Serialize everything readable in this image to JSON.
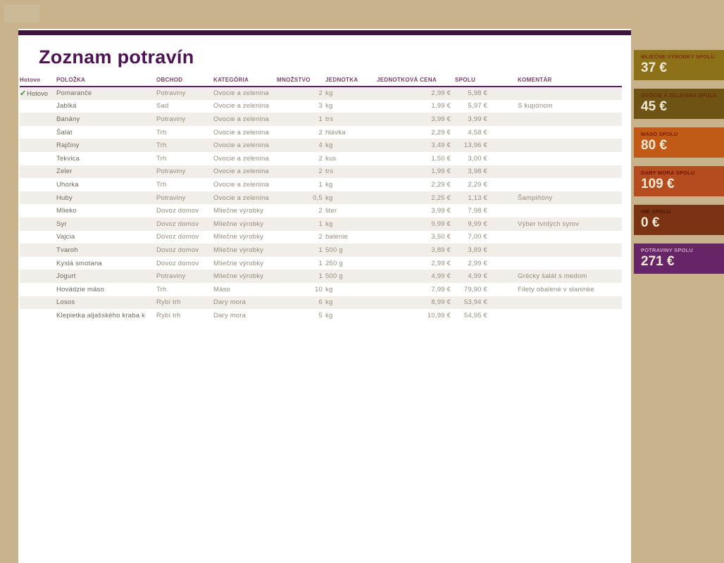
{
  "app": {
    "title": "Zoznam potravín"
  },
  "colors": {
    "page_background": "#C7B28C",
    "top_bar": "#40123F",
    "title_text": "#4C1552",
    "header_text": "#7B4166",
    "header_underline": "#5A1F5C",
    "row_stripe": "#F1EEE9",
    "body_text": "#958B7B",
    "check_green": "#2F8A32"
  },
  "table": {
    "done_text": "Hotovo",
    "headers": {
      "done": "Hotovo",
      "item": "POLOŽKA",
      "store": "OBCHOD",
      "category": "KATEGÓRIA",
      "qty": "MNOŽSTVO",
      "unit": "JEDNOTKA",
      "unit_price": "JEDNOTKOVÁ CENA",
      "total": "SPOLU",
      "comment": "KOMENTÁR"
    },
    "rows": [
      {
        "done": true,
        "item": "Pomaranče",
        "store": "Potraviny",
        "category": "Ovocie a zelenina",
        "qty": "2",
        "unit": "kg",
        "unit_price": "2,99 €",
        "total": "5,98 €",
        "comment": ""
      },
      {
        "done": false,
        "item": "Jablká",
        "store": "Sad",
        "category": "Ovocie a zelenina",
        "qty": "3",
        "unit": "kg",
        "unit_price": "1,99 €",
        "total": "5,97 €",
        "comment": "S kupónom"
      },
      {
        "done": false,
        "item": "Banány",
        "store": "Potraviny",
        "category": "Ovocie a zelenina",
        "qty": "1",
        "unit": "trs",
        "unit_price": "3,99 €",
        "total": "3,99 €",
        "comment": ""
      },
      {
        "done": false,
        "item": "Šalát",
        "store": "Trh",
        "category": "Ovocie a zelenina",
        "qty": "2",
        "unit": "hlávka",
        "unit_price": "2,29 €",
        "total": "4,58 €",
        "comment": ""
      },
      {
        "done": false,
        "item": "Rajčiny",
        "store": "Trh",
        "category": "Ovocie a zelenina",
        "qty": "4",
        "unit": "kg",
        "unit_price": "3,49 €",
        "total": "13,96 €",
        "comment": ""
      },
      {
        "done": false,
        "item": "Tekvica",
        "store": "Trh",
        "category": "Ovocie a zelenina",
        "qty": "2",
        "unit": "kus",
        "unit_price": "1,50 €",
        "total": "3,00 €",
        "comment": ""
      },
      {
        "done": false,
        "item": "Zeler",
        "store": "Potraviny",
        "category": "Ovocie a zelenina",
        "qty": "2",
        "unit": "trs",
        "unit_price": "1,99 €",
        "total": "3,98 €",
        "comment": ""
      },
      {
        "done": false,
        "item": "Uhorka",
        "store": "Trh",
        "category": "Ovocie a zelenina",
        "qty": "1",
        "unit": "kg",
        "unit_price": "2,29 €",
        "total": "2,29 €",
        "comment": ""
      },
      {
        "done": false,
        "item": "Huby",
        "store": "Potraviny",
        "category": "Ovocie a zelenina",
        "qty": "0,5",
        "unit": "kg",
        "unit_price": "2,25 €",
        "total": "1,13 €",
        "comment": "Šampiňóny"
      },
      {
        "done": false,
        "item": "Mlieko",
        "store": "Dovoz domov",
        "category": "Mliečne výrobky",
        "qty": "2",
        "unit": "liter",
        "unit_price": "3,99 €",
        "total": "7,98 €",
        "comment": ""
      },
      {
        "done": false,
        "item": "Syr",
        "store": "Dovoz domov",
        "category": "Mliečne výrobky",
        "qty": "1",
        "unit": "kg",
        "unit_price": "9,99 €",
        "total": "9,99 €",
        "comment": "Výber tvrdých syrov"
      },
      {
        "done": false,
        "item": "Vajcia",
        "store": "Dovoz domov",
        "category": "Mliečne výrobky",
        "qty": "2",
        "unit": "balenie",
        "unit_price": "3,50 €",
        "total": "7,00 €",
        "comment": ""
      },
      {
        "done": false,
        "item": "Tvaroh",
        "store": "Dovoz domov",
        "category": "Mliečne výrobky",
        "qty": "1",
        "unit": "500 g",
        "unit_price": "3,89 €",
        "total": "3,89 €",
        "comment": ""
      },
      {
        "done": false,
        "item": "Kyslá smotana",
        "store": "Dovoz domov",
        "category": "Mliečne výrobky",
        "qty": "1",
        "unit": "250 g",
        "unit_price": "2,99 €",
        "total": "2,99 €",
        "comment": ""
      },
      {
        "done": false,
        "item": "Jogurt",
        "store": "Potraviny",
        "category": "Mliečne výrobky",
        "qty": "1",
        "unit": "500 g",
        "unit_price": "4,99 €",
        "total": "4,99 €",
        "comment": "Grécky šalát s medom"
      },
      {
        "done": false,
        "item": "Hovädzie mäso",
        "store": "Trh",
        "category": "Mäso",
        "qty": "10",
        "unit": "kg",
        "unit_price": "7,99 €",
        "total": "79,90 €",
        "comment": "Filety obalené v slaninke"
      },
      {
        "done": false,
        "item": "Losos",
        "store": "Rybí trh",
        "category": "Dary mora",
        "qty": "6",
        "unit": "kg",
        "unit_price": "8,99 €",
        "total": "53,94 €",
        "comment": ""
      },
      {
        "done": false,
        "item": "Klepietka aljašského kraba k",
        "store": "Rybí trh",
        "category": "Dary mora",
        "qty": "5",
        "unit": "kg",
        "unit_price": "10,99 €",
        "total": "54,95 €",
        "comment": ""
      }
    ]
  },
  "summary": {
    "cards": [
      {
        "label": "MLIEČNE VÝROBKY SPOLU",
        "value": "37 €",
        "bg": "#8D7118",
        "label_color": "#7F3110"
      },
      {
        "label": "OVOCIE A ZELENINA SPOLU",
        "value": "45 €",
        "bg": "#6E5314",
        "label_color": "#6E2708"
      },
      {
        "label": "MÄSO SPOLU",
        "value": "80 €",
        "bg": "#C05A16",
        "label_color": "#7E1A02"
      },
      {
        "label": "DARY MORA SPOLU",
        "value": "109 €",
        "bg": "#B44C20",
        "label_color": "#6E1402"
      },
      {
        "label": "INÉ SPOLU",
        "value": "0 €",
        "bg": "#7A3414",
        "label_color": "#4E150B"
      },
      {
        "label": "POTRAVINY SPOLU",
        "value": "271 €",
        "bg": "#662567",
        "label_color": "#C9A2C8"
      }
    ]
  }
}
